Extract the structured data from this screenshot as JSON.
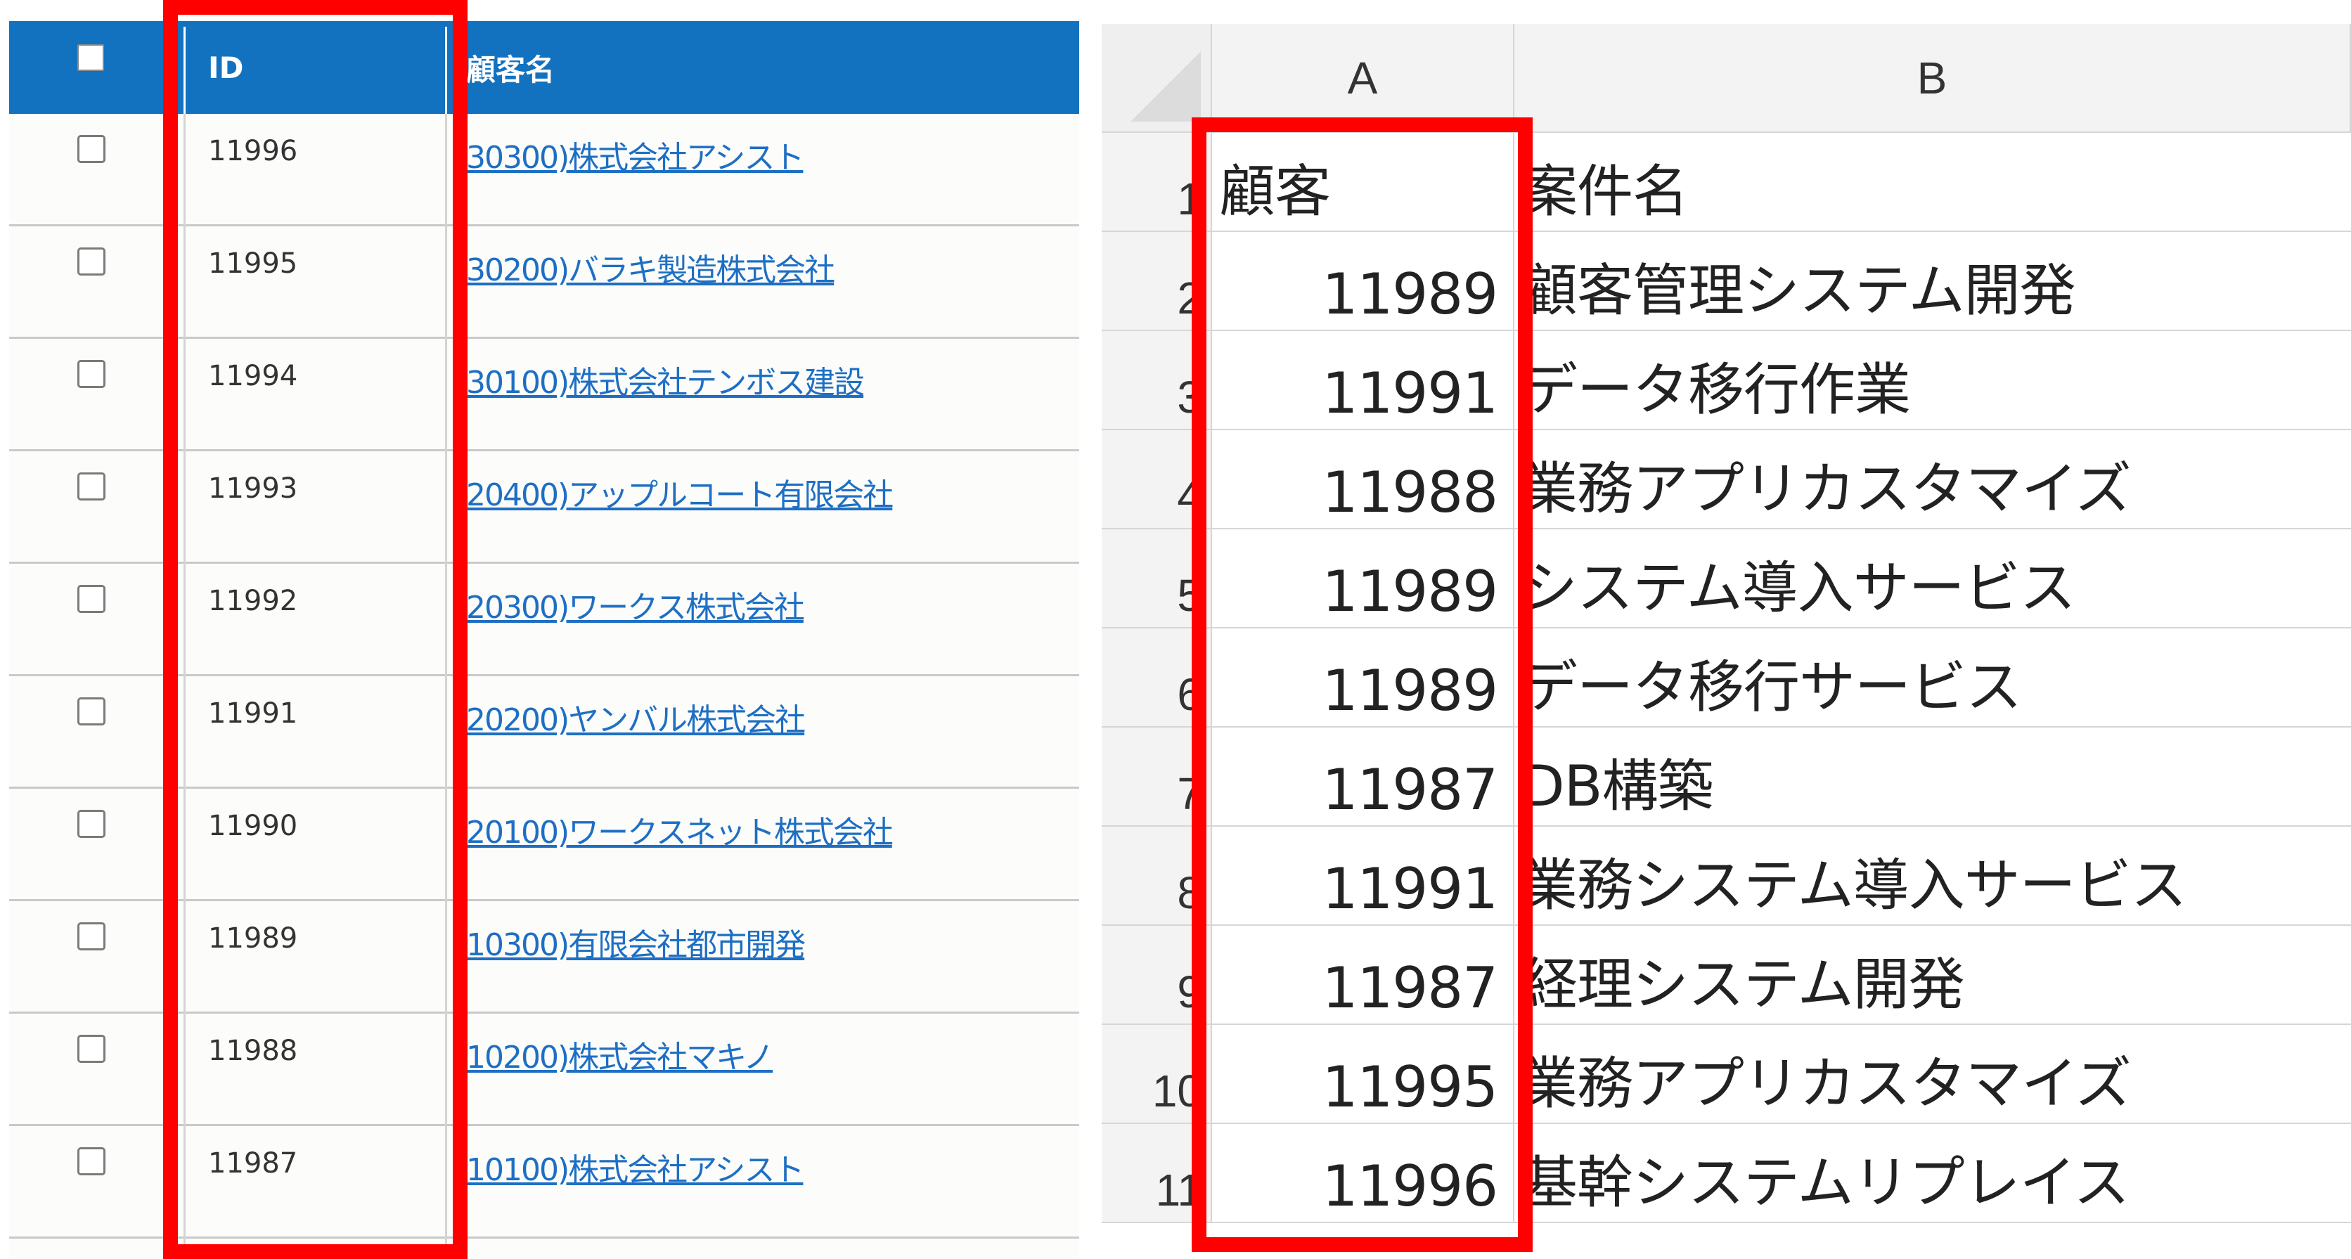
{
  "list": {
    "headers": {
      "id": "ID",
      "name": "顧客名"
    },
    "rows": [
      {
        "id": "11996",
        "name": "30300)株式会社アシスト"
      },
      {
        "id": "11995",
        "name": "30200)バラキ製造株式会社"
      },
      {
        "id": "11994",
        "name": "30100)株式会社テンボス建設"
      },
      {
        "id": "11993",
        "name": "20400)アップルコート有限会社"
      },
      {
        "id": "11992",
        "name": "20300)ワークス株式会社"
      },
      {
        "id": "11991",
        "name": "20200)ヤンバル株式会社"
      },
      {
        "id": "11990",
        "name": "20100)ワークスネット株式会社"
      },
      {
        "id": "11989",
        "name": "10300)有限会社都市開発"
      },
      {
        "id": "11988",
        "name": "10200)株式会社マキノ"
      },
      {
        "id": "11987",
        "name": "10100)株式会社アシスト"
      }
    ]
  },
  "sheet": {
    "columns": [
      "A",
      "B"
    ],
    "rows": [
      {
        "num": "1",
        "a": "顧客",
        "b": "案件名"
      },
      {
        "num": "2",
        "a": "11989",
        "b": "顧客管理システム開発"
      },
      {
        "num": "3",
        "a": "11991",
        "b": "データ移行作業"
      },
      {
        "num": "4",
        "a": "11988",
        "b": "業務アプリカスタマイズ"
      },
      {
        "num": "5",
        "a": "11989",
        "b": "システム導入サービス"
      },
      {
        "num": "6",
        "a": "11989",
        "b": "データ移行サービス"
      },
      {
        "num": "7",
        "a": "11987",
        "b": "DB構築"
      },
      {
        "num": "8",
        "a": "11991",
        "b": "業務システム導入サービス"
      },
      {
        "num": "9",
        "a": "11987",
        "b": "経理システム開発"
      },
      {
        "num": "10",
        "a": "11995",
        "b": "業務アプリカスタマイズ"
      },
      {
        "num": "11",
        "a": "11996",
        "b": "基幹システムリプレイス"
      }
    ]
  },
  "colors": {
    "list_header_bg": "#1272c0",
    "link": "#1e6fc4",
    "highlight": "#ff0000"
  }
}
